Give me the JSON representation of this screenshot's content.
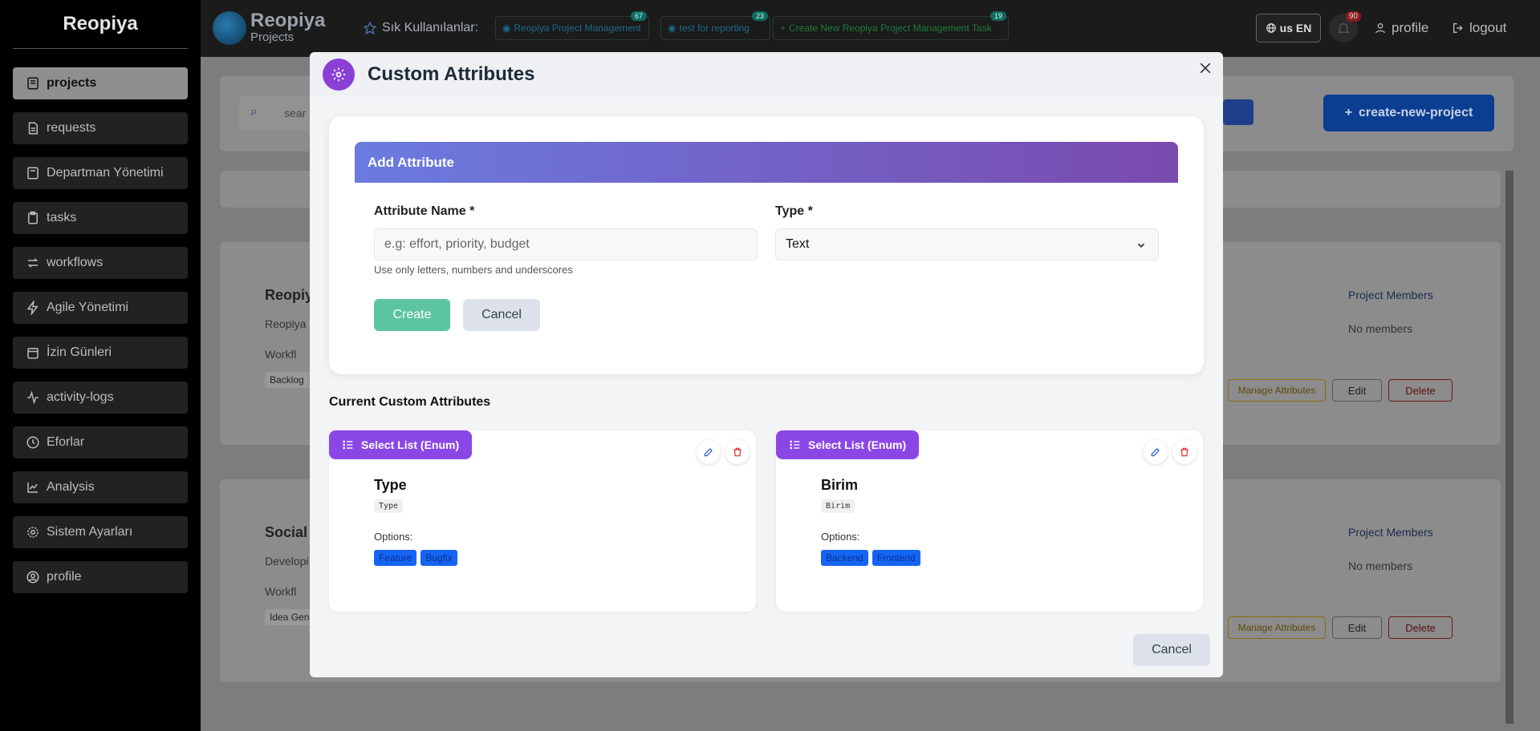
{
  "sidebar": {
    "brand": "Reopiya",
    "items": [
      {
        "label": "projects",
        "icon": "projects-icon",
        "active": true
      },
      {
        "label": "requests",
        "icon": "document-icon"
      },
      {
        "label": "Departman Yönetimi",
        "icon": "department-icon"
      },
      {
        "label": "tasks",
        "icon": "clipboard-icon"
      },
      {
        "label": "workflows",
        "icon": "workflow-icon"
      },
      {
        "label": "Agile Yönetimi",
        "icon": "lightning-icon"
      },
      {
        "label": "İzin Günleri",
        "icon": "calendar-icon"
      },
      {
        "label": "activity-logs",
        "icon": "activity-icon"
      },
      {
        "label": "Eforlar",
        "icon": "clock-icon"
      },
      {
        "label": "Analysis",
        "icon": "chart-icon"
      },
      {
        "label": "Sistem Ayarları",
        "icon": "gear-icon"
      },
      {
        "label": "profile",
        "icon": "user-circle-icon"
      }
    ]
  },
  "topbar": {
    "logo_title": "Reopiya",
    "logo_subtitle": "Projects",
    "favorites_label": "Sık Kullanılanlar:",
    "favorites": [
      {
        "label": "Reopiya Project Management",
        "count": "67"
      },
      {
        "label": "test for reporting",
        "count": "23"
      },
      {
        "label": "Create New Reopiya Project Management Task",
        "count": "19"
      }
    ],
    "language": "us EN",
    "notifications": "90",
    "profile": "profile",
    "logout": "logout"
  },
  "background": {
    "search_placeholder": "sear",
    "create_button": "create-new-project",
    "projects": [
      {
        "title": "Reopiy",
        "desc": "Reopiya",
        "workflow": "Workfl",
        "stage": "Backlog",
        "members_title": "Project Members",
        "members": "No members"
      },
      {
        "title": "Social I",
        "desc": "Developi",
        "workflow": "Workfl",
        "stage": "Idea Gen",
        "members_title": "Project Members",
        "members": "No members"
      }
    ],
    "manage_attributes": "Manage Attributes",
    "edit": "Edit",
    "delete": "Delete"
  },
  "modal": {
    "title": "Custom Attributes",
    "add_section_title": "Add Attribute",
    "name_label": "Attribute Name *",
    "name_placeholder": "e.g: effort, priority, budget",
    "name_hint": "Use only letters, numbers and underscores",
    "type_label": "Type *",
    "type_value": "Text",
    "create_button": "Create",
    "cancel_button": "Cancel",
    "current_title": "Current Custom Attributes",
    "options_label": "Options:",
    "attributes": [
      {
        "tag": "Select List (Enum)",
        "name": "Type",
        "code": "Type",
        "options": [
          "Feature",
          "Bugfix"
        ]
      },
      {
        "tag": "Select List (Enum)",
        "name": "Birim",
        "code": "Birim",
        "options": [
          "Backend",
          "Frontend"
        ]
      }
    ],
    "footer_cancel": "Cancel"
  }
}
